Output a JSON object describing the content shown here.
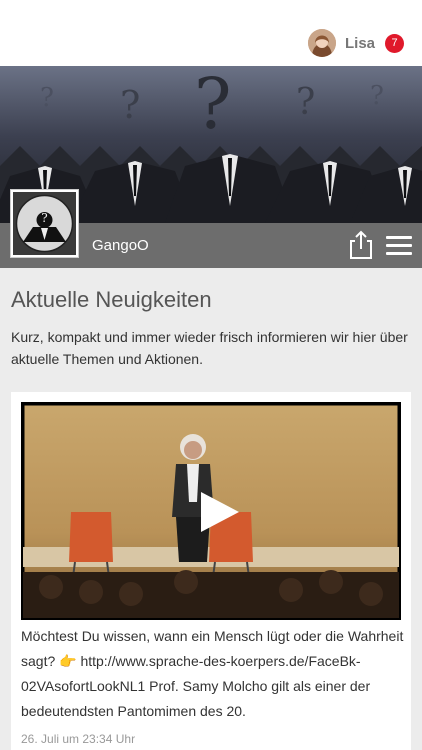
{
  "header": {
    "user_name": "Lisa",
    "notification_count": "7"
  },
  "page": {
    "name": "GangoO",
    "logo_text": "GangoO"
  },
  "section": {
    "title": "Aktuelle Neuigkeiten",
    "intro": "Kurz, kompakt und immer wieder frisch informieren wir hier über aktuelle Themen und Aktionen."
  },
  "post": {
    "text": "Möchtest Du wissen, wann ein Mensch lügt oder die Wahrheit sagt? 👉 http://www.sprache-des-koerpers.de/FaceBk-02VAsofortLookNL1 Prof. Samy Molcho gilt als einer der bedeutendsten Pantomimen des 20.",
    "timestamp": "26. Juli um 23:34 Uhr"
  },
  "colors": {
    "badge": "#e0192b",
    "page_bar": "#6d6d6d",
    "background": "#ececec"
  },
  "icons": [
    "share-icon",
    "hamburger-menu-icon",
    "play-icon"
  ]
}
